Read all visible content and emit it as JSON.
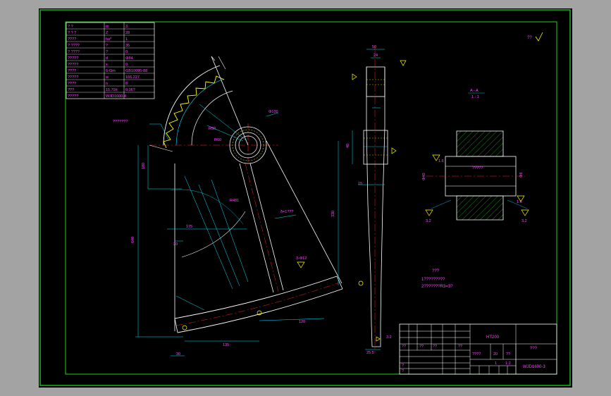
{
  "colors": {
    "frame_bg": "#9a9a9a",
    "drawing_bg": "#000000",
    "border": "#1fd11f",
    "lines": "#ffffff",
    "dims": "#00e5ff",
    "text": "#ff44ff",
    "center": "#ff2222",
    "teeth": "#ffff00",
    "hatch": "#33dd33"
  },
  "param_table": [
    [
      "? ?",
      "m",
      "3"
    ],
    [
      "? ? ?",
      "Z",
      "28"
    ],
    [
      "????",
      "ha*",
      "1"
    ],
    [
      "? ????",
      "?",
      "35"
    ],
    [
      "? ????",
      "?",
      "0"
    ],
    [
      "?????",
      "d",
      "Φ84"
    ],
    [
      "?????",
      "x",
      "0"
    ],
    [
      "????",
      "6-Gm",
      "GB10095-88"
    ],
    [
      "?????",
      "w",
      "166.227"
    ],
    [
      "????",
      "n",
      "8"
    ],
    [
      "???",
      "15.79±",
      "0.06?"
    ],
    [
      "?????",
      "WJD1600-4",
      ""
    ]
  ],
  "top_right_note": "??",
  "section": {
    "label": "A - A",
    "scale": "1 : 1"
  },
  "labels": {
    "gear_callout": "???????",
    "hub_dim": "Φ100",
    "dim_r": "R60",
    "dim_r2": "R50",
    "dim_ray": "R481",
    "dim_175": "175",
    "dim_640": "640",
    "dim_180": "180",
    "dim_330": "330",
    "dim_120": "120",
    "dim_135": "135",
    "dim_30": "30",
    "dim_20": "20",
    "dim_side_50": "50",
    "dim_side_24": "24",
    "dim_side_40": "40",
    "dim_side_15": "15",
    "dim_side_255": "25.5",
    "rib_note": "δ=1???",
    "slot_note": "3-Φ12",
    "side_ref": "3.2",
    "keyway_note": "?????",
    "sec_dim1": "Φ40",
    "sec_dim2": "Φ8",
    "sec_ra1": "1.6",
    "sec_ra2": "1.6",
    "sec_ra3": "3.2",
    "sec_ra4": "3.2"
  },
  "notes": {
    "title": "???",
    "line1": "1?????????",
    "line2": "2???????R3=3?"
  },
  "title_block": {
    "material": "HT200",
    "part_name": "???",
    "drawing_no": "WJD1600-3",
    "scale": "1:2",
    "qty": "1",
    "mass": "20",
    "extra_cells": [
      "??",
      "??",
      "??",
      "??",
      "????",
      "??",
      "?",
      "?"
    ]
  }
}
